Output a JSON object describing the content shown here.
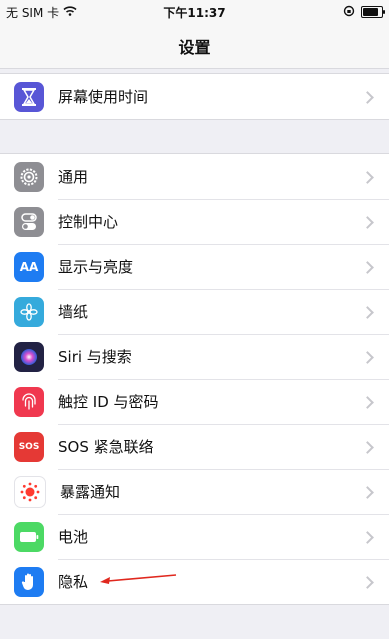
{
  "status_bar": {
    "carrier": "无 SIM 卡",
    "time": "下午11:37"
  },
  "navbar": {
    "title": "设置"
  },
  "settings": {
    "group1": [
      {
        "label": "屏幕使用时间",
        "icon": "hourglass-icon",
        "color": "#5856d6"
      }
    ],
    "group2": [
      {
        "label": "通用",
        "icon": "gear-icon",
        "color": "#8e8e93"
      },
      {
        "label": "控制中心",
        "icon": "toggles-icon",
        "color": "#8e8e93"
      },
      {
        "label": "显示与亮度",
        "icon": "display-aa-icon",
        "color": "#1e7cf2",
        "glyph": "AA"
      },
      {
        "label": "墙纸",
        "icon": "flower-icon",
        "color": "#35aadc"
      },
      {
        "label": "Siri 与搜索",
        "icon": "siri-icon",
        "color": "#222244"
      },
      {
        "label": "触控 ID 与密码",
        "icon": "fingerprint-icon",
        "color": "#f0384f"
      },
      {
        "label": "SOS 紧急联络",
        "icon": "sos-icon",
        "color": "#e53935",
        "glyph": "SOS"
      },
      {
        "label": "暴露通知",
        "icon": "exposure-icon",
        "color": "#ffffff"
      },
      {
        "label": "电池",
        "icon": "battery-icon",
        "color": "#4cd964"
      },
      {
        "label": "隐私",
        "icon": "hand-icon",
        "color": "#1e7cf2"
      }
    ]
  }
}
